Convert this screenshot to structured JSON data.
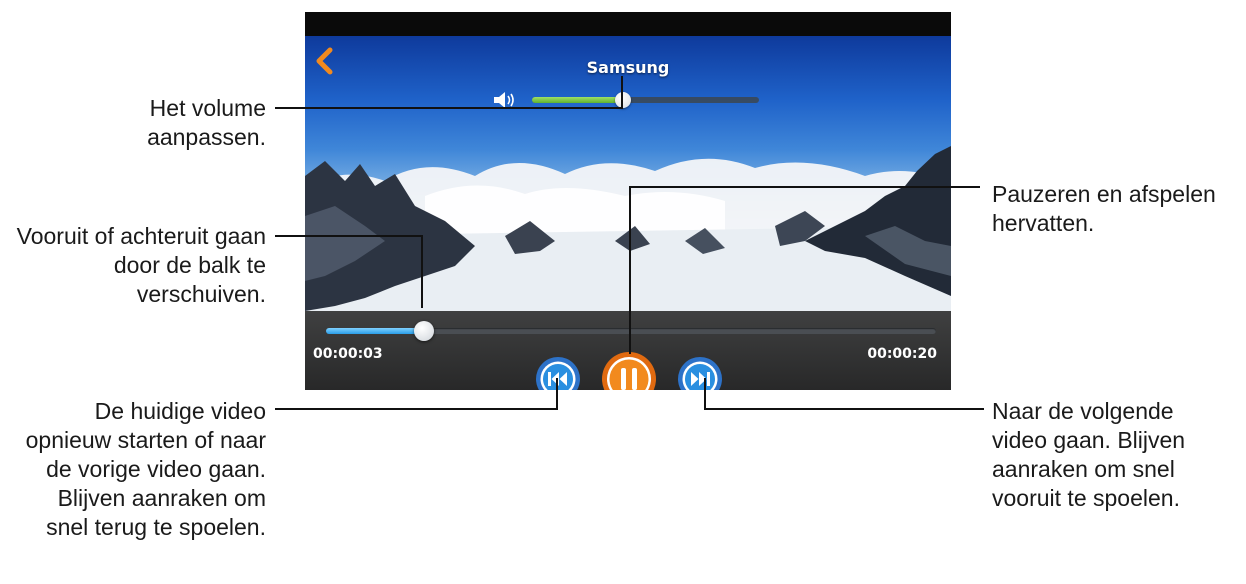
{
  "player": {
    "title": "Samsung",
    "back_icon": "chevron-left-icon",
    "volume_icon": "speaker-icon",
    "volume_level": 0.4,
    "progress_fraction": 0.16,
    "current_time": "00:00:03",
    "total_time": "00:00:20",
    "accent_blue": "#2a9ee8",
    "volume_green": "#5fb130",
    "pause_orange": "#f28a1e",
    "controls": {
      "previous_icon": "skip-previous-icon",
      "pause_icon": "pause-icon",
      "next_icon": "skip-next-icon"
    }
  },
  "callouts": {
    "volume": "Het volume aanpassen.",
    "seek": "Vooruit of achteruit gaan door de balk te verschuiven.",
    "pause": "Pauzeren en afspelen hervatten.",
    "previous": "De huidige video opnieuw starten of naar de vorige video gaan. Blijven aanraken om snel terug te spoelen.",
    "next": "Naar de volgende video gaan. Blijven aanraken om snel vooruit te spoelen."
  }
}
